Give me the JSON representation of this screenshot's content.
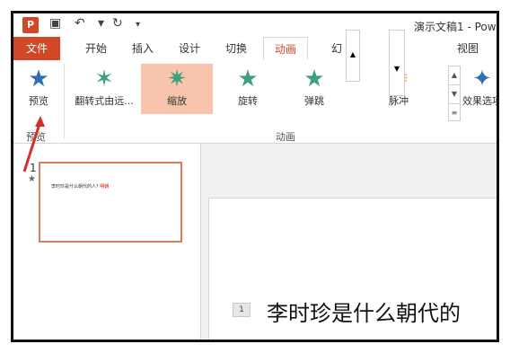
{
  "titlebar": {
    "app_logo": "P",
    "save_icon": "save-icon",
    "undo_icon": "undo-icon",
    "redo_icon": "redo-icon",
    "doc_title": "演示文稿1 - Pow"
  },
  "tabs": {
    "file": "文件",
    "home": "开始",
    "insert": "插入",
    "design": "设计",
    "transitions": "切换",
    "animations": "动画",
    "slideshow_partial": "幻",
    "view": "视图",
    "overlay_view": "视图"
  },
  "ribbon": {
    "preview_label": "预览",
    "preview_group": "预览",
    "animations_group": "动画",
    "effects_label": "效果选项",
    "animations": [
      {
        "label": "翻转式由远..."
      },
      {
        "label": "缩放"
      },
      {
        "label": "旋转"
      },
      {
        "label": "弹跳"
      },
      {
        "label": "脉冲"
      }
    ]
  },
  "slides_panel": {
    "slide_number": "1",
    "thumb_text": "李时珍是什么朝代的人?",
    "thumb_answer": "明朝"
  },
  "editor": {
    "slide_index_label": "1",
    "slide_text": "李时珍是什么朝代的"
  },
  "colors": {
    "accent": "#d24726",
    "star_green": "#3f9f7e",
    "selected_bg": "#f8c5ac",
    "thumb_border": "#e07b5d"
  }
}
